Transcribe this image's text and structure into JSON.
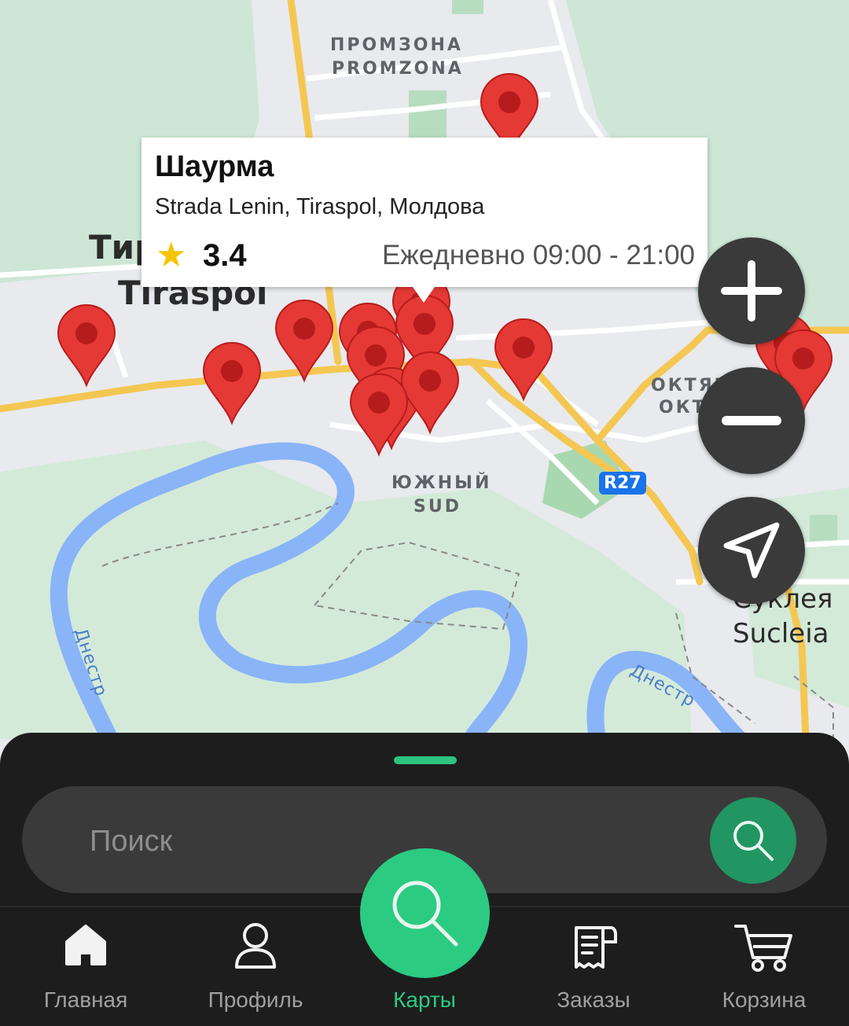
{
  "map": {
    "labels": {
      "promzona_ru": "ПРОМЗОНА",
      "promzona_en": "PROMZONA",
      "city_ru": "Тир",
      "city_en": "Tiraspol",
      "sud_ru": "ЮЖНЫЙ",
      "sud_en": "SUD",
      "okt_ru_1": "ОКТЯБ",
      "okt_ru_2": "ОКТ",
      "sucleia_ru": "Суклея",
      "sucleia_en": "Sucleia",
      "river_1": "Днестр",
      "river_2": "Днестр",
      "road_badge": "R27"
    },
    "marker_color": "#e53935"
  },
  "popup": {
    "title": "Шаурма",
    "address": "Strada Lenin, Tiraspol, Молдова",
    "rating": "3.4",
    "star_icon": "star-icon",
    "hours": "Ежедневно 09:00 - 21:00"
  },
  "map_controls": {
    "zoom_in_icon": "plus-icon",
    "zoom_out_icon": "minus-icon",
    "locate_icon": "navigation-arrow-icon"
  },
  "search": {
    "placeholder": "Поиск",
    "value": "",
    "button_icon": "search-icon"
  },
  "bottom_nav": {
    "items": [
      {
        "label": "Главная",
        "icon": "home-icon"
      },
      {
        "label": "Профиль",
        "icon": "profile-icon"
      },
      {
        "label": "Карты",
        "icon": "search-icon",
        "active": true
      },
      {
        "label": "Заказы",
        "icon": "receipt-icon"
      },
      {
        "label": "Корзина",
        "icon": "cart-icon"
      }
    ]
  },
  "colors": {
    "accent": "#2bcb82",
    "sheet_bg": "#1d1d1d",
    "search_bg": "#3a3a3a",
    "search_button": "#219663"
  }
}
